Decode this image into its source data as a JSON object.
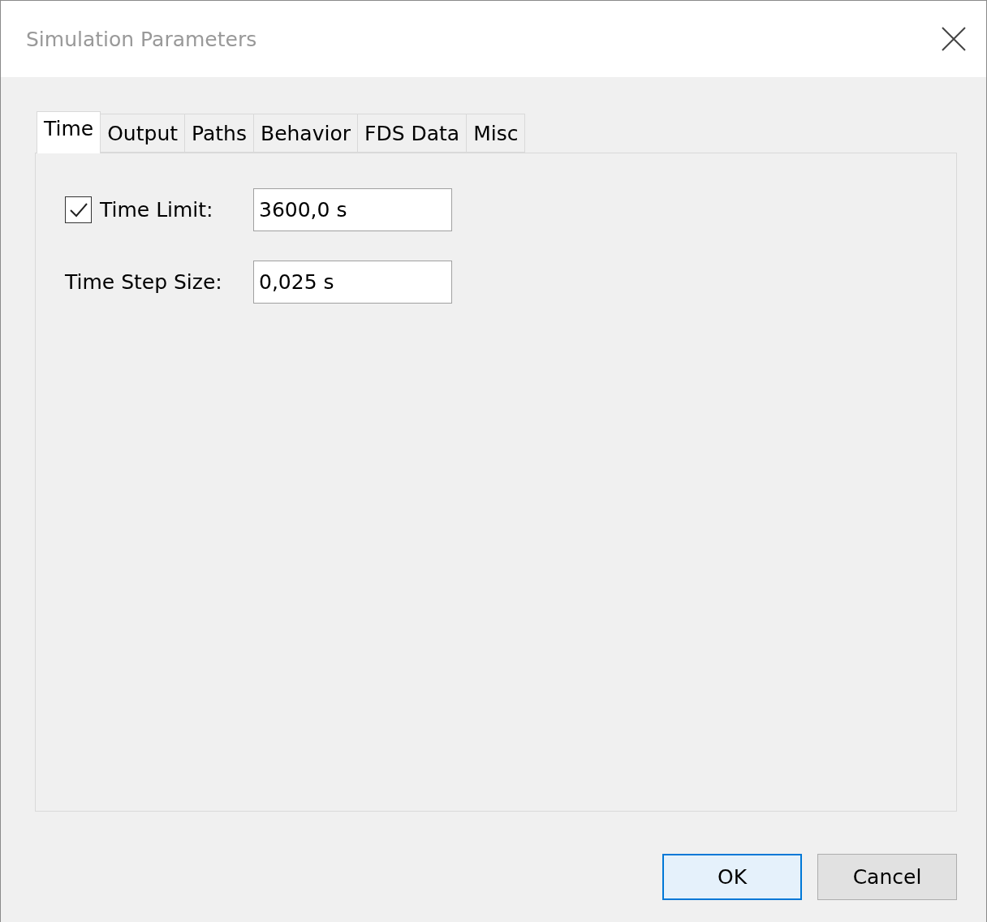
{
  "window": {
    "title": "Simulation Parameters"
  },
  "tabs": [
    {
      "label": "Time",
      "selected": true
    },
    {
      "label": "Output",
      "selected": false
    },
    {
      "label": "Paths",
      "selected": false
    },
    {
      "label": "Behavior",
      "selected": false
    },
    {
      "label": "FDS Data",
      "selected": false
    },
    {
      "label": "Misc",
      "selected": false
    }
  ],
  "fields": [
    {
      "kind": "checkbox",
      "label": "Time Limit:",
      "checked": true,
      "value": "3600,0 s"
    },
    {
      "kind": "plain",
      "label": "Time Step Size:",
      "value": "0,025 s"
    }
  ],
  "buttons": [
    {
      "label": "OK",
      "default": true
    },
    {
      "label": "Cancel",
      "default": false
    }
  ]
}
